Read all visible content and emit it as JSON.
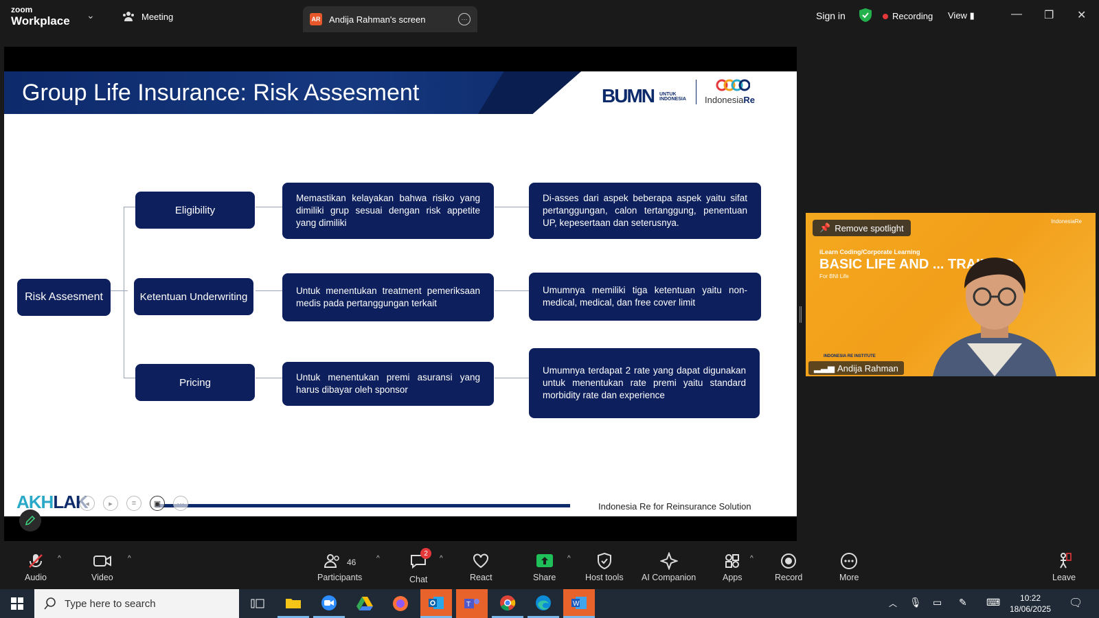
{
  "app": {
    "brand_top": "zoom",
    "brand_bottom": "Workplace",
    "meeting_tab": "Meeting",
    "screen_tab_badge": "AR",
    "screen_tab_label": "Andija Rahman's screen",
    "sign_in": "Sign in",
    "recording": "Recording",
    "view": "View"
  },
  "slide": {
    "title": "Group Life Insurance: Risk Assesment",
    "logo_bumn": "BUMN",
    "logo_bumn_sub1": "UNTUK",
    "logo_bumn_sub2": "INDONESIA",
    "logo_ire_a": "Indonesia",
    "logo_ire_b": "Re",
    "root": "Risk Assesment",
    "rows": [
      {
        "label": "Eligibility",
        "desc1": "Memastikan kelayakan bahwa risiko yang dimiliki grup sesuai dengan risk appetite yang dimiliki",
        "desc2": "Di-asses dari aspek beberapa aspek yaitu sifat pertanggungan, calon tertanggung, penentuan UP, kepesertaan dan seterusnya."
      },
      {
        "label": "Ketentuan Underwriting",
        "desc1": "Untuk menentukan treatment pemeriksaan medis pada pertanggungan terkait",
        "desc2": "Umumnya memiliki tiga ketentuan yaitu non-medical, medical, dan free cover limit"
      },
      {
        "label": "Pricing",
        "desc1": "Untuk menentukan premi asuransi yang harus dibayar oleh sponsor",
        "desc2": "Umumnya terdapat 2 rate yang dapat digunakan untuk menentukan rate premi yaitu standard morbidity rate dan experience"
      }
    ],
    "footer": "Indonesia Re for Reinsurance Solution",
    "akhlak_a": "AKH",
    "akhlak_b": "LAK"
  },
  "video": {
    "remove_spotlight": "Remove spotlight",
    "banner_small": "iLearn Coding/Corporate Learning",
    "banner_big": "BASIC LIFE AND ... TRAINING",
    "banner_sub": "For BNI Life",
    "logos": "IndonesiaRe",
    "institute": "INDONESIA RE INSTITUTE",
    "name": "Andija Rahman"
  },
  "toolbar": {
    "audio": "Audio",
    "video": "Video",
    "participants": "Participants",
    "participants_count": "46",
    "chat": "Chat",
    "chat_badge": "2",
    "react": "React",
    "share": "Share",
    "host_tools": "Host tools",
    "ai_companion": "AI Companion",
    "apps": "Apps",
    "record": "Record",
    "more": "More",
    "leave": "Leave"
  },
  "taskbar": {
    "search_placeholder": "Type here to search",
    "time": "10:22",
    "date": "18/06/2025"
  },
  "colors": {
    "slide_navy": "#0d1f5c",
    "recording_red": "#e5383b",
    "share_green": "#1fbf5a",
    "tile_orange": "#f4a81e"
  }
}
